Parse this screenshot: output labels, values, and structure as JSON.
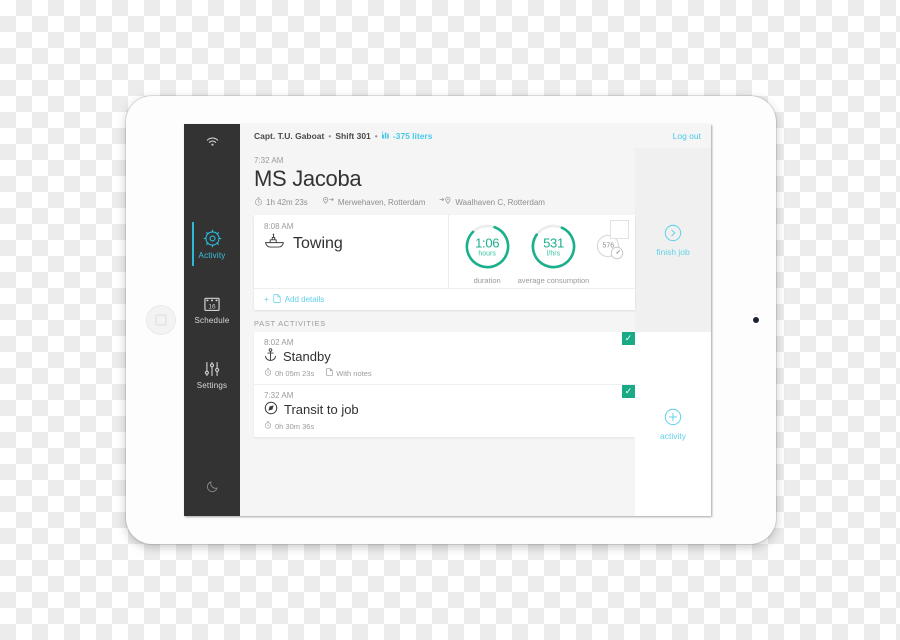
{
  "colors": {
    "accent_cyan": "#49c9e8",
    "gauge_green": "#19b08c",
    "check_green": "#1aab86",
    "sidebar_bg": "#333333",
    "screen_bg": "#f5f5f5"
  },
  "device": {
    "home_button": "home-button",
    "camera": "front-camera"
  },
  "sidebar": {
    "wifi_icon": "wifi-icon",
    "items": [
      {
        "label": "Activity",
        "icon": "ship-wheel-icon",
        "active": true
      },
      {
        "label": "Schedule",
        "icon": "calendar-icon",
        "calendar_day": "16",
        "active": false
      },
      {
        "label": "Settings",
        "icon": "sliders-icon",
        "active": false
      }
    ],
    "bottom_icon": "moon-icon"
  },
  "topbar": {
    "captain": "Capt. T.U. Gaboat",
    "shift": "Shift 301",
    "fuel_icon": "bar-chart-icon",
    "fuel": "-375 liters",
    "logout": "Log out",
    "separator": "•"
  },
  "job": {
    "time": "7:32 AM",
    "title": "MS Jacoba",
    "duration_icon": "stopwatch-icon",
    "duration": "1h 42m 23s",
    "from_icon": "pin-depart-icon",
    "from": "Merwehaven, Rotterdam",
    "to_icon": "pin-arrive-icon",
    "to": "Waalhaven C, Rotterdam"
  },
  "current_activity": {
    "time": "8:08 AM",
    "icon": "tugboat-icon",
    "name": "Towing",
    "gauges": [
      {
        "value": "1:06",
        "unit": "hours",
        "caption": "duration",
        "percent": 82
      },
      {
        "value": "531",
        "unit": "l/hrs",
        "caption": "average consumption",
        "percent": 78
      }
    ],
    "mini_gauge": {
      "value": "576",
      "icon": "speedometer-icon"
    },
    "corner_icon": "fold-square-icon",
    "add_details": {
      "plus": "+",
      "icon": "document-icon",
      "label": "Add details"
    }
  },
  "actions": [
    {
      "label": "finish job",
      "icon": "chevron-right-circle-icon"
    },
    {
      "label": "activity",
      "icon": "plus-circle-icon"
    }
  ],
  "past_activities": {
    "heading": "PAST ACTIVITIES",
    "rows": [
      {
        "time": "8:02 AM",
        "icon": "anchor-icon",
        "name": "Standby",
        "duration_icon": "stopwatch-icon",
        "duration": "0h 05m 23s",
        "notes_icon": "document-icon",
        "notes": "With notes",
        "checked": true,
        "check_glyph": "✓"
      },
      {
        "time": "7:32 AM",
        "icon": "compass-icon",
        "name": "Transit to job",
        "duration_icon": "stopwatch-icon",
        "duration": "0h 30m 36s",
        "notes_icon": null,
        "notes": null,
        "checked": true,
        "check_glyph": "✓"
      }
    ]
  }
}
